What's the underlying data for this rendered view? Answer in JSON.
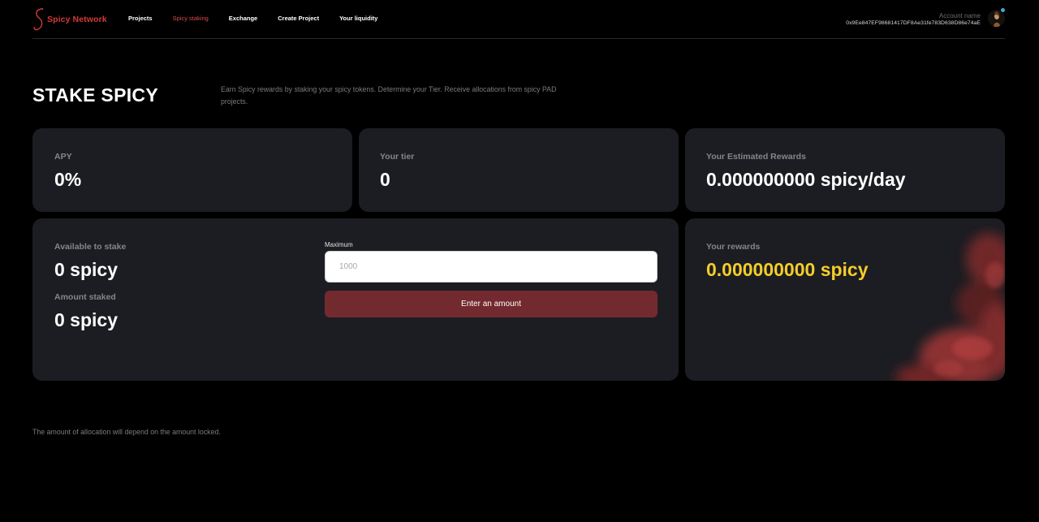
{
  "header": {
    "brand": "Spicy Network",
    "nav": [
      {
        "label": "Projects",
        "active": false
      },
      {
        "label": "Spicy staking",
        "active": true
      },
      {
        "label": "Exchange",
        "active": false
      },
      {
        "label": "Create Project",
        "active": false
      },
      {
        "label": "Your liquidity",
        "active": false
      }
    ],
    "account_name": "Account name",
    "account_address": "0x9Ee847EF98681417DF8Ae31fe783D638D86e74aE"
  },
  "page": {
    "title": "STAKE SPICY",
    "description": "Earn Spicy rewards by staking your spicy tokens. Determine your Tier. Receive allocations from spicy PAD projects."
  },
  "stats": {
    "apy_label": "APY",
    "apy_value": "0%",
    "tier_label": "Your tier",
    "tier_value": "0",
    "est_rewards_label": "Your Estimated Rewards",
    "est_rewards_value": "0.000000000 spicy/day"
  },
  "stake": {
    "available_label": "Available to stake",
    "available_value": "0 spicy",
    "staked_label": "Amount staked",
    "staked_value": "0 spicy",
    "input_label": "Maximum",
    "input_placeholder": "1000",
    "input_value": "",
    "button_label": "Enter an amount"
  },
  "rewards": {
    "label": "Your rewards",
    "value": "0.000000000 spicy"
  },
  "footnote": "The amount of allocation will depend on the amount locked.",
  "colors": {
    "background": "#000000",
    "card": "#1c1d22",
    "brand_red": "#d43a3a",
    "button": "#732a2f",
    "reward_yellow": "#f4cd2a"
  }
}
